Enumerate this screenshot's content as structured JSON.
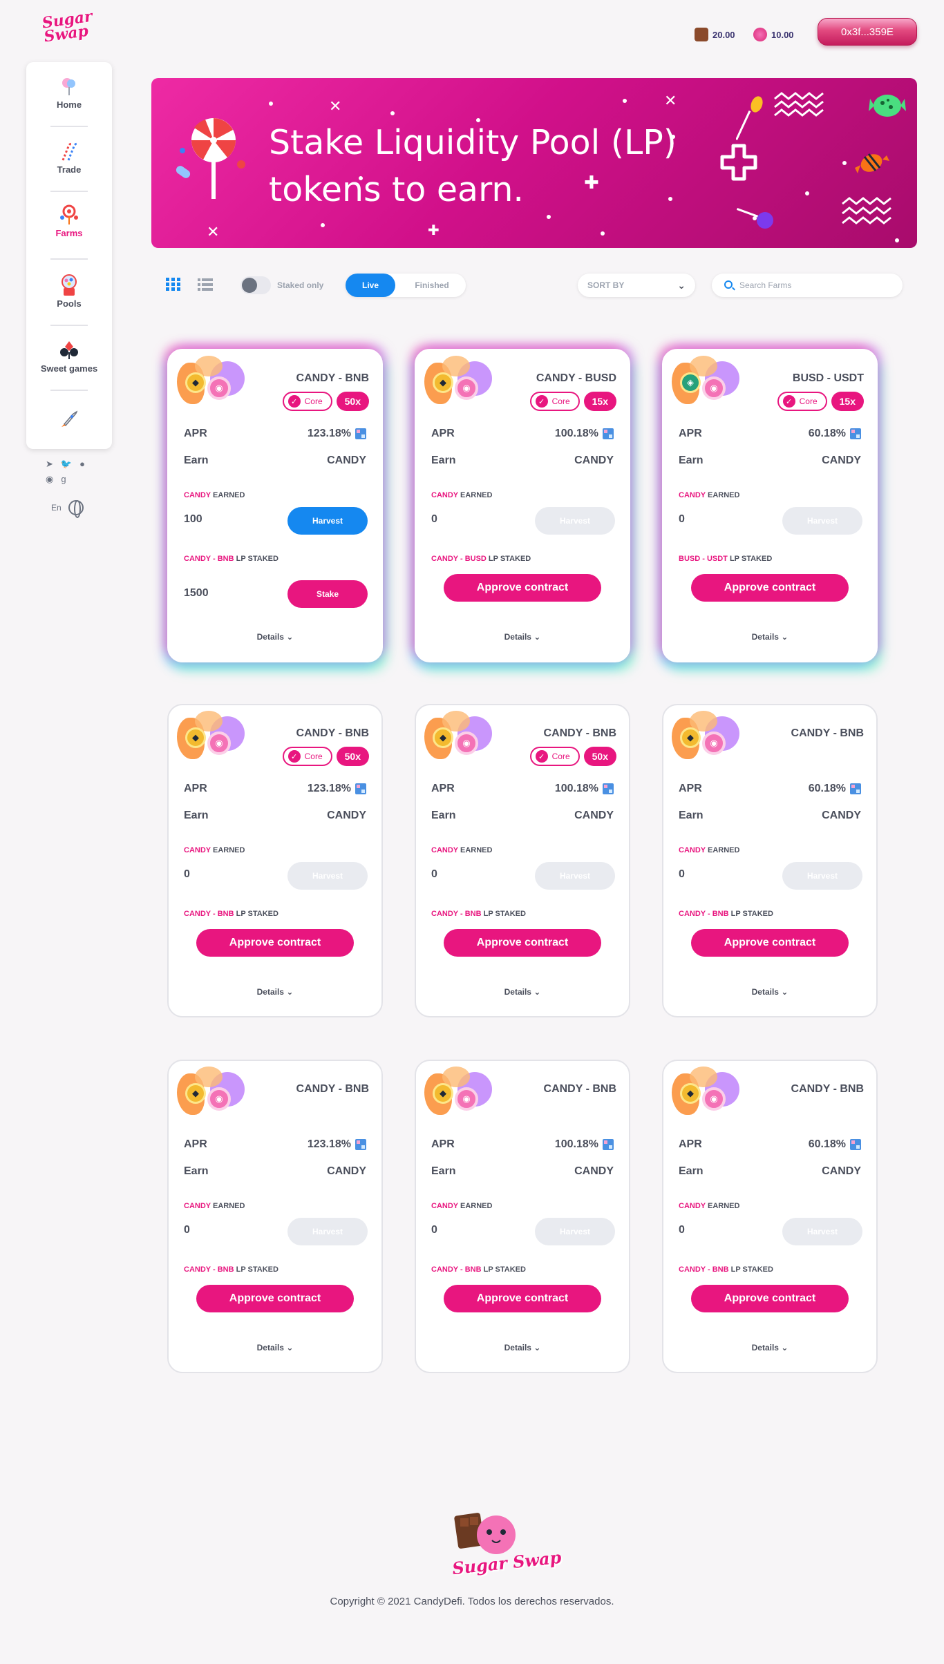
{
  "header": {
    "logo_text": "Sugar Swap",
    "balances": [
      {
        "icon": "chocolate-icon",
        "value": "20.00"
      },
      {
        "icon": "candy-icon",
        "value": "10.00"
      }
    ],
    "wallet": "0x3f...359E"
  },
  "sidebar": {
    "items": [
      {
        "label": "Home",
        "icon": "cotton-candy-icon"
      },
      {
        "label": "Trade",
        "icon": "candy-cane-icon"
      },
      {
        "label": "Farms",
        "icon": "lollipop-icon",
        "active": true
      },
      {
        "label": "Pools",
        "icon": "gumball-machine-icon"
      },
      {
        "label": "Sweet games",
        "icon": "card-suits-icon"
      },
      {
        "label": "",
        "icon": "rocket-icon"
      }
    ],
    "language": "En"
  },
  "banner": {
    "line1": "Stake Liquidity Pool (LP)",
    "line2": "tokens to earn."
  },
  "controls": {
    "staked_only": "Staked only",
    "tab_live": "Live",
    "tab_finished": "Finished",
    "sort_label": "SORT BY",
    "search_placeholder": "Search Farms"
  },
  "labels": {
    "apr": "APR",
    "earn": "Earn",
    "earned_suffix": "EARNED",
    "staked_suffix": "LP STAKED",
    "harvest": "Harvest",
    "stake": "Stake",
    "approve": "Approve contract",
    "details": "Details",
    "core": "Core"
  },
  "farms": [
    {
      "pair": "CANDY - BNB",
      "core": true,
      "multiplier": "50x",
      "apr": "123.18%",
      "earn": "CANDY",
      "earned_token": "CANDY",
      "earned": "100",
      "staked_pair": "CANDY - BNB",
      "staked": "1500",
      "harvest_enabled": true,
      "approved": true,
      "token_b": "BNB"
    },
    {
      "pair": "CANDY - BUSD",
      "core": true,
      "multiplier": "15x",
      "apr": "100.18%",
      "earn": "CANDY",
      "earned_token": "CANDY",
      "earned": "0",
      "staked_pair": "CANDY - BUSD",
      "harvest_enabled": false,
      "approved": false,
      "token_b": "BUSD"
    },
    {
      "pair": "BUSD - USDT",
      "core": true,
      "multiplier": "15x",
      "apr": "60.18%",
      "earn": "CANDY",
      "earned_token": "CANDY",
      "earned": "0",
      "staked_pair": "BUSD - USDT",
      "harvest_enabled": false,
      "approved": false,
      "token_b": "USDT"
    },
    {
      "pair": "CANDY - BNB",
      "core": true,
      "multiplier": "50x",
      "apr": "123.18%",
      "earn": "CANDY",
      "earned_token": "CANDY",
      "earned": "0",
      "staked_pair": "CANDY - BNB",
      "harvest_enabled": false,
      "approved": false,
      "token_b": "BNB"
    },
    {
      "pair": "CANDY - BNB",
      "core": true,
      "multiplier": "50x",
      "apr": "100.18%",
      "earn": "CANDY",
      "earned_token": "CANDY",
      "earned": "0",
      "staked_pair": "CANDY - BNB",
      "harvest_enabled": false,
      "approved": false,
      "token_b": "BNB"
    },
    {
      "pair": "CANDY - BNB",
      "core": false,
      "multiplier": "",
      "apr": "60.18%",
      "earn": "CANDY",
      "earned_token": "CANDY",
      "earned": "0",
      "staked_pair": "CANDY - BNB",
      "harvest_enabled": false,
      "approved": false,
      "token_b": "BNB"
    },
    {
      "pair": "CANDY - BNB",
      "core": false,
      "multiplier": "",
      "apr": "123.18%",
      "earn": "CANDY",
      "earned_token": "CANDY",
      "earned": "0",
      "staked_pair": "CANDY - BNB",
      "harvest_enabled": false,
      "approved": false,
      "token_b": "BNB"
    },
    {
      "pair": "CANDY - BNB",
      "core": false,
      "multiplier": "",
      "apr": "100.18%",
      "earn": "CANDY",
      "earned_token": "CANDY",
      "earned": "0",
      "staked_pair": "CANDY - BNB",
      "harvest_enabled": false,
      "approved": false,
      "token_b": "BNB"
    },
    {
      "pair": "CANDY - BNB",
      "core": false,
      "multiplier": "",
      "apr": "60.18%",
      "earn": "CANDY",
      "earned_token": "CANDY",
      "earned": "0",
      "staked_pair": "CANDY - BNB",
      "harvest_enabled": false,
      "approved": false,
      "token_b": "BNB"
    }
  ],
  "footer": {
    "logo_text": "Sugar Swap",
    "copyright": "Copyright © 2021 CandyDefi. Todos los derechos reservados."
  },
  "colors": {
    "accent": "#e8167f",
    "blue": "#1588f0"
  }
}
